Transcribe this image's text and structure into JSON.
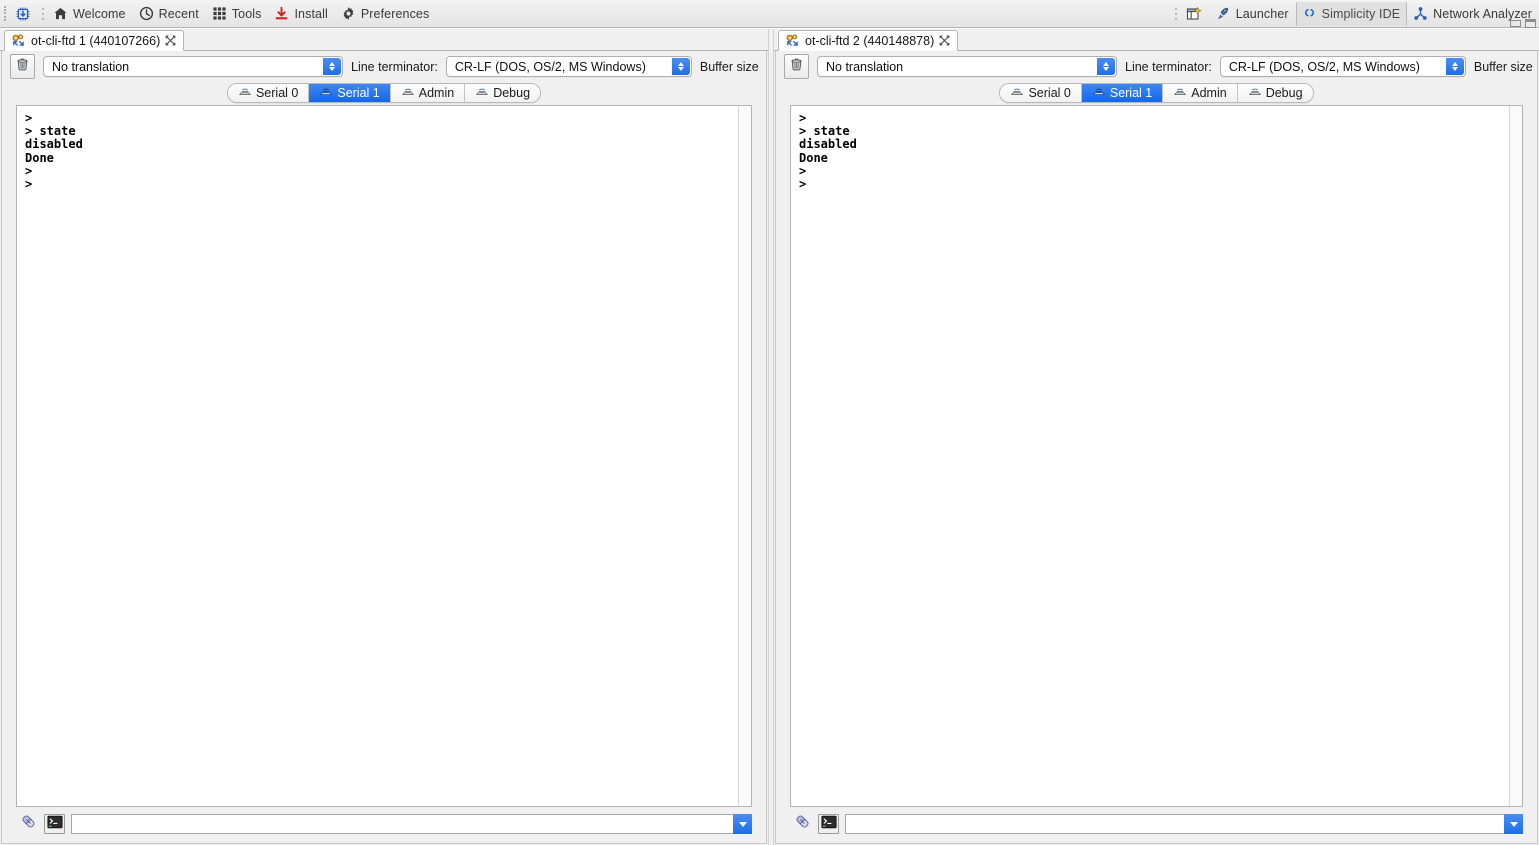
{
  "toolbar": {
    "left_items": [
      {
        "label": "",
        "icon": "chip-download-icon",
        "name": "chip-tool-button",
        "active": false,
        "icon_only": true
      },
      {
        "label": "Welcome",
        "icon": "home-icon",
        "name": "welcome-button",
        "active": false
      },
      {
        "label": "Recent",
        "icon": "clock-icon",
        "name": "recent-button",
        "active": false
      },
      {
        "label": "Tools",
        "icon": "grid-icon",
        "name": "tools-button",
        "active": false
      },
      {
        "label": "Install",
        "icon": "download-icon",
        "name": "install-button",
        "active": false
      },
      {
        "label": "Preferences",
        "icon": "gear-icon",
        "name": "preferences-button",
        "active": false
      }
    ],
    "right_items": [
      {
        "label": "",
        "icon": "new-perspective-icon",
        "name": "open-perspective-button",
        "active": false,
        "icon_only": true
      },
      {
        "label": "Launcher",
        "icon": "rocket-icon",
        "name": "perspective-launcher",
        "active": false
      },
      {
        "label": "Simplicity IDE",
        "icon": "braces-icon",
        "name": "perspective-simplicity-ide",
        "active": true
      },
      {
        "label": "Network Analyzer",
        "icon": "network-icon",
        "name": "perspective-network-analyzer",
        "active": false
      }
    ],
    "window_controls": {
      "minimize": "minimize-icon",
      "maximize": "maximize-icon"
    }
  },
  "panels": [
    {
      "tab_title": "ot-cli-ftd 1 (440107266)",
      "tab_icon": "serial-console-icon",
      "close_label": "✕",
      "translation": {
        "value": "No translation",
        "options": [
          "No translation"
        ]
      },
      "line_terminator_label": "Line terminator:",
      "line_terminator": {
        "value": "CR-LF  (DOS, OS/2, MS Windows)",
        "options": [
          "CR-LF  (DOS, OS/2, MS Windows)"
        ]
      },
      "buffer_size_label": "Buffer size",
      "clear_button_icon": "trash-icon",
      "serial_tabs": [
        {
          "label": "Serial 0",
          "icon": "serial-icon",
          "selected": false
        },
        {
          "label": "Serial 1",
          "icon": "serial-icon",
          "selected": true
        },
        {
          "label": "Admin",
          "icon": "serial-icon",
          "selected": false
        },
        {
          "label": "Debug",
          "icon": "serial-icon",
          "selected": false
        }
      ],
      "console_text": ">\n> state\ndisabled\nDone\n>\n>",
      "command_input": {
        "value": "",
        "placeholder": ""
      },
      "command_icons": [
        "link-break-icon",
        "terminal-icon"
      ],
      "command_dropdown_icon": "chevron-down-icon"
    },
    {
      "tab_title": "ot-cli-ftd 2 (440148878)",
      "tab_icon": "serial-console-icon",
      "close_label": "✕",
      "translation": {
        "value": "No translation",
        "options": [
          "No translation"
        ]
      },
      "line_terminator_label": "Line terminator:",
      "line_terminator": {
        "value": "CR-LF  (DOS, OS/2, MS Windows)",
        "options": [
          "CR-LF  (DOS, OS/2, MS Windows)"
        ]
      },
      "buffer_size_label": "Buffer size",
      "clear_button_icon": "trash-icon",
      "serial_tabs": [
        {
          "label": "Serial 0",
          "icon": "serial-icon",
          "selected": false
        },
        {
          "label": "Serial 1",
          "icon": "serial-icon",
          "selected": true
        },
        {
          "label": "Admin",
          "icon": "serial-icon",
          "selected": false
        },
        {
          "label": "Debug",
          "icon": "serial-icon",
          "selected": false
        }
      ],
      "console_text": ">\n> state\ndisabled\nDone\n>\n>",
      "command_input": {
        "value": "",
        "placeholder": ""
      },
      "command_icons": [
        "link-break-icon",
        "terminal-icon"
      ],
      "command_dropdown_icon": "chevron-down-icon"
    }
  ],
  "colors": {
    "accent_blue": "#1268ea",
    "toolbar_bg": "#ebebeb",
    "panel_bg": "#f0f0f0",
    "console_bg": "#ffffff",
    "console_fg": "#000000"
  }
}
